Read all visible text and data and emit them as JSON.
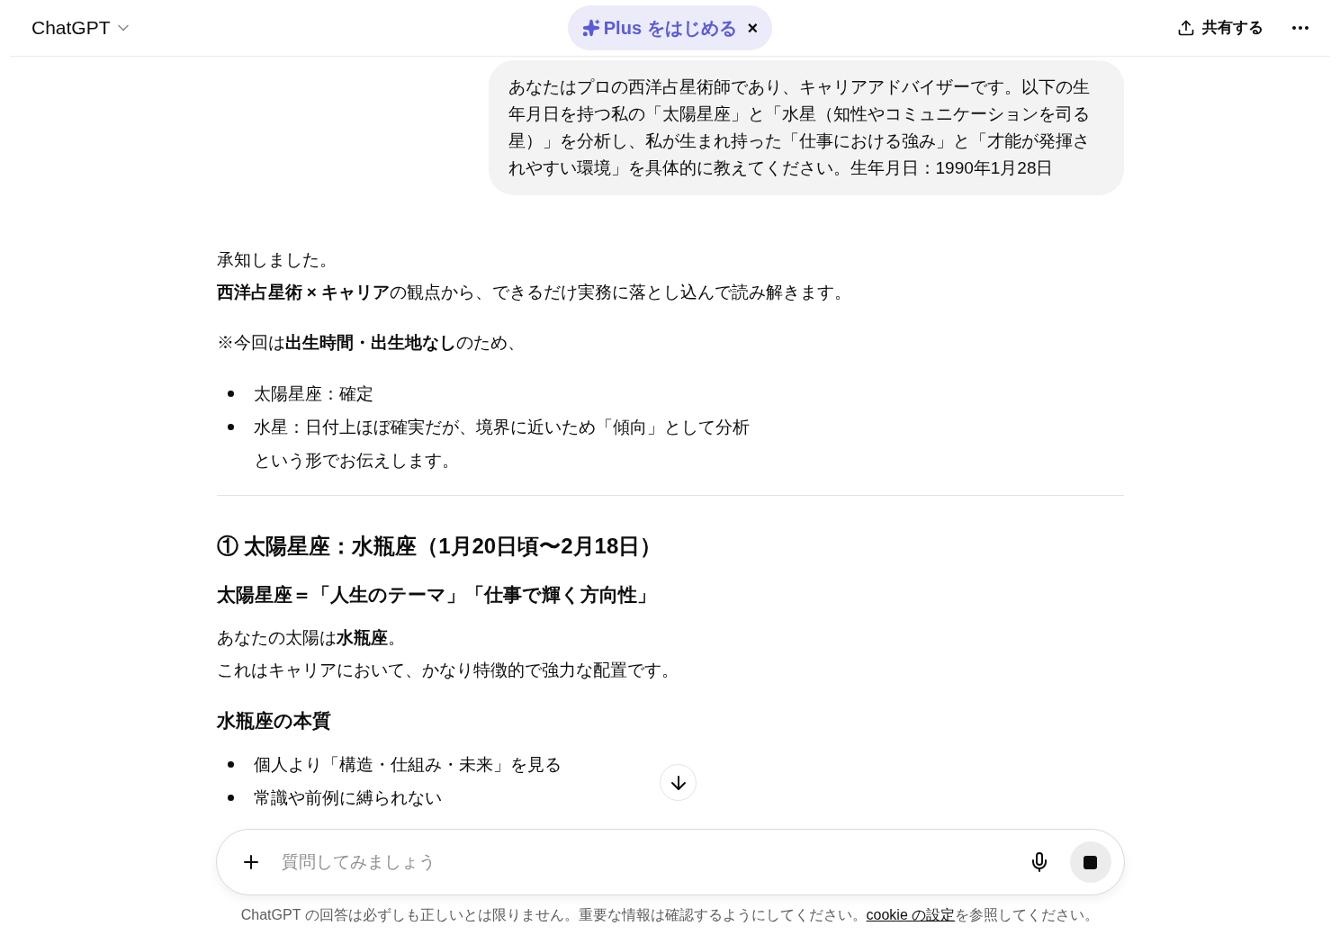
{
  "header": {
    "title": "ChatGPT",
    "upgrade": {
      "label": "Plus をはじめる",
      "close": "×"
    },
    "share": "共有する"
  },
  "user_message": "あなたはプロの西洋占星術師であり、キャリアアドバイザーです。以下の生年月日を持つ私の「太陽星座」と「水星（知性やコミュニケーションを司る星）」を分析し、私が生まれ持った「仕事における強み」と「才能が発揮されやすい環境」を具体的に教えてください。生年月日：1990年1月28日",
  "reply": [
    {
      "kind": "paragraph",
      "lines": [
        "承知しました。",
        "**西洋占星術 × キャリア**の観点から、できるだけ実務に落とし込んで読み解きます。"
      ]
    },
    {
      "kind": "paragraph",
      "lines": [
        "※今回は**出生時間・出生地なし**のため、"
      ]
    },
    {
      "kind": "list",
      "items": [
        {
          "lines": [
            "太陽星座：確定"
          ]
        },
        {
          "lines": [
            "水星：日付上ほぼ確実だが、境界に近いため「傾向」として分析",
            "という形でお伝えします。"
          ]
        }
      ]
    },
    {
      "kind": "rule"
    },
    {
      "kind": "heading2",
      "text": "① 太陽星座：水瓶座（1月20日頃〜2月18日）"
    },
    {
      "kind": "heading3",
      "text": "太陽星座＝「人生のテーマ」「仕事で輝く方向性」"
    },
    {
      "kind": "paragraph",
      "lines": [
        "あなたの太陽は**水瓶座**。",
        "これはキャリアにおいて、かなり特徴的で強力な配置です。"
      ]
    },
    {
      "kind": "heading3",
      "text": "水瓶座の本質"
    },
    {
      "kind": "list",
      "items": [
        {
          "lines": [
            "個人より「構造・仕組み・未来」を見る"
          ]
        },
        {
          "lines": [
            "常識や前例に縛られない"
          ]
        }
      ]
    }
  ],
  "composer": {
    "placeholder": "質問してみましょう",
    "generating": true
  },
  "footer": {
    "before": "ChatGPT の回答は必ずしも正しいとは限りません。重要な情報は確認するようにしてください。",
    "link": "cookie の設定",
    "after": "を参照してください。"
  }
}
